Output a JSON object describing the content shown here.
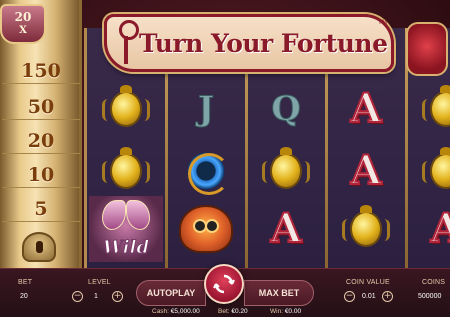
{
  "game": {
    "title": "Turn Your Fortune",
    "trademark": "TM"
  },
  "multiplier_drum": {
    "badge_value": "20",
    "badge_x": "X",
    "rows": [
      "150",
      "50",
      "20",
      "10",
      "5"
    ]
  },
  "reels": {
    "wild_label": "Wild",
    "letters": {
      "A": "A",
      "Q": "Q",
      "J": "J"
    }
  },
  "controls": {
    "bet_label": "BET",
    "bet_value": "20",
    "level_label": "LEVEL",
    "level_value": "1",
    "autoplay_label": "AUTOPLAY",
    "maxbet_label": "MAX BET",
    "coin_value_label": "COIN VALUE",
    "coin_value": "0.01",
    "coins_label": "COINS",
    "coins_value": "500000",
    "minus": "−",
    "plus": "+"
  },
  "status": {
    "cash_label": "Cash:",
    "cash_value": "€5,000.00",
    "bet_label": "Bet:",
    "bet_value": "€0.20",
    "win_label": "Win:",
    "win_value": "€0.00"
  },
  "colors": {
    "accent": "#8a1a2a",
    "gold": "#d8b070",
    "spin": "#c0283a"
  }
}
